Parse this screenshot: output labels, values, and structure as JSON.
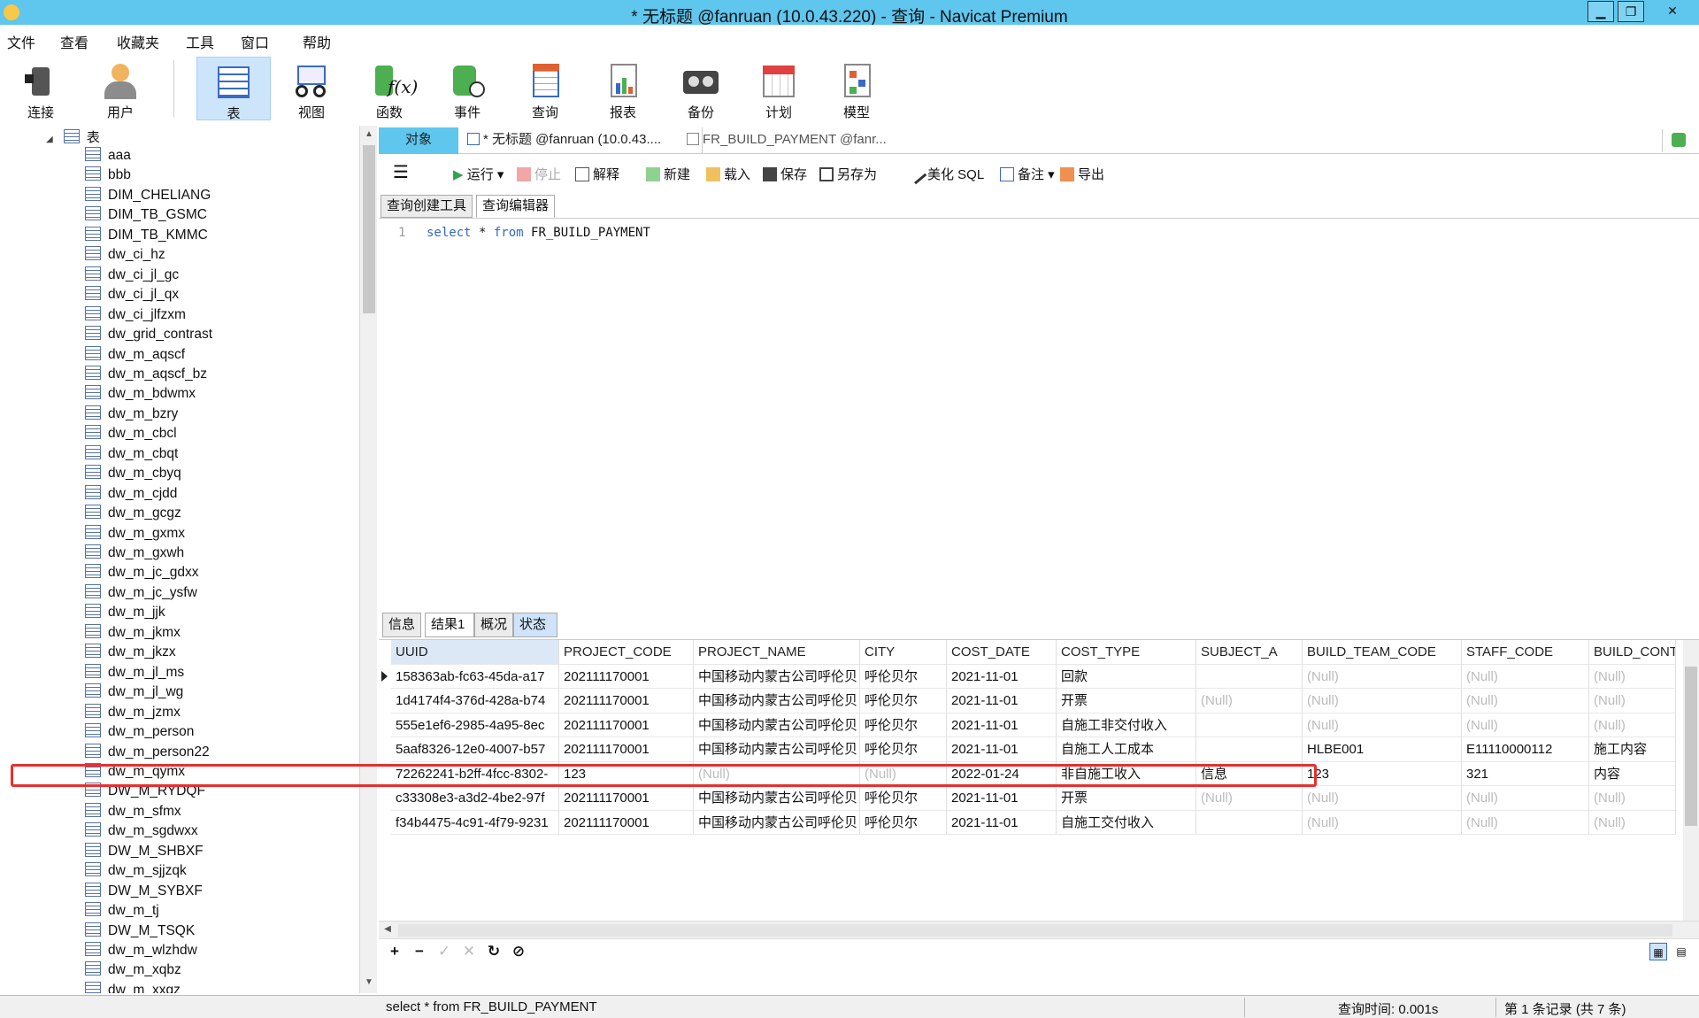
{
  "window": {
    "title": "* 无标题 @fanruan (10.0.43.220) - 查询 - Navicat Premium",
    "minimize": "▁",
    "restore": "❐",
    "close": "✕"
  },
  "menu": [
    "文件",
    "查看",
    "收藏夹",
    "工具",
    "窗口",
    "帮助"
  ],
  "toolbar": [
    {
      "label": "连接",
      "icon": "plug-icon"
    },
    {
      "label": "用户",
      "icon": "user-icon"
    },
    {
      "label": "表",
      "icon": "table-icon",
      "active": true
    },
    {
      "label": "视图",
      "icon": "glasses-icon"
    },
    {
      "label": "函数",
      "icon": "function-icon"
    },
    {
      "label": "事件",
      "icon": "event-icon"
    },
    {
      "label": "查询",
      "icon": "query-icon"
    },
    {
      "label": "报表",
      "icon": "report-icon"
    },
    {
      "label": "备份",
      "icon": "backup-icon"
    },
    {
      "label": "计划",
      "icon": "calendar-icon"
    },
    {
      "label": "模型",
      "icon": "model-icon"
    }
  ],
  "tree": {
    "root": "表",
    "items": [
      "aaa",
      "bbb",
      "DIM_CHELIANG",
      "DIM_TB_GSMC",
      "DIM_TB_KMMC",
      "dw_ci_hz",
      "dw_ci_jl_gc",
      "dw_ci_jl_qx",
      "dw_ci_jlfzxm",
      "dw_grid_contrast",
      "dw_m_aqscf",
      "dw_m_aqscf_bz",
      "dw_m_bdwmx",
      "dw_m_bzry",
      "dw_m_cbcl",
      "dw_m_cbqt",
      "dw_m_cbyq",
      "dw_m_cjdd",
      "dw_m_gcgz",
      "dw_m_gxmx",
      "dw_m_gxwh",
      "dw_m_jc_gdxx",
      "dw_m_jc_ysfw",
      "dw_m_jjk",
      "dw_m_jkmx",
      "dw_m_jkzx",
      "dw_m_jl_ms",
      "dw_m_jl_wg",
      "dw_m_jzmx",
      "dw_m_person",
      "dw_m_person22",
      "dw_m_qymx",
      "DW_M_RYDQF",
      "dw_m_sfmx",
      "dw_m_sgdwxx",
      "DW_M_SHBXF",
      "dw_m_sjjzqk",
      "DW_M_SYBXF",
      "dw_m_tj",
      "DW_M_TSQK",
      "dw_m_wlzhdw",
      "dw_m_xqbz",
      "dw_m_xxqz"
    ]
  },
  "tabs": {
    "object": "对象",
    "query": "* 无标题 @fanruan (10.0.43....",
    "table": "FR_BUILD_PAYMENT @fanr..."
  },
  "query_toolbar": {
    "menu": "☰",
    "run": "运行",
    "stop": "停止",
    "explain": "解释",
    "new": "新建",
    "load": "载入",
    "save": "保存",
    "save_as": "另存为",
    "beautify": "美化 SQL",
    "comment": "备注",
    "export": "导出"
  },
  "subtabs": [
    "查询创建工具",
    "查询编辑器"
  ],
  "editor": {
    "line": "1",
    "kw1": "select",
    "mid": " * ",
    "kw2": "from",
    "rest": " FR_BUILD_PAYMENT"
  },
  "result_tabs": [
    "信息",
    "结果1",
    "概况",
    "状态"
  ],
  "grid": {
    "columns": [
      "UUID",
      "PROJECT_CODE",
      "PROJECT_NAME",
      "CITY",
      "COST_DATE",
      "COST_TYPE",
      "SUBJECT_A",
      "BUILD_TEAM_CODE",
      "STAFF_CODE",
      "BUILD_CONT"
    ],
    "rows": [
      [
        "158363ab-fc63-45da-a17",
        "202111170001",
        "中国移动内蒙古公司呼伦贝",
        "呼伦贝尔",
        "2021-11-01",
        "回款",
        "",
        "(Null)",
        "(Null)",
        "(Null)"
      ],
      [
        "1d4174f4-376d-428a-b74",
        "202111170001",
        "中国移动内蒙古公司呼伦贝",
        "呼伦贝尔",
        "2021-11-01",
        "开票",
        "(Null)",
        "(Null)",
        "(Null)",
        "(Null)"
      ],
      [
        "555e1ef6-2985-4a95-8ec",
        "202111170001",
        "中国移动内蒙古公司呼伦贝",
        "呼伦贝尔",
        "2021-11-01",
        "自施工非交付收入",
        "",
        "(Null)",
        "(Null)",
        "(Null)"
      ],
      [
        "5aaf8326-12e0-4007-b57",
        "202111170001",
        "中国移动内蒙古公司呼伦贝",
        "呼伦贝尔",
        "2021-11-01",
        "自施工人工成本",
        "",
        "HLBE001",
        "E11110000112",
        "施工内容"
      ],
      [
        "72262241-b2ff-4fcc-8302-",
        "123",
        "(Null)",
        "(Null)",
        "2022-01-24",
        "非自施工收入",
        "信息",
        "123",
        "321",
        "内容"
      ],
      [
        "c33308e3-a3d2-4be2-97f",
        "202111170001",
        "中国移动内蒙古公司呼伦贝",
        "呼伦贝尔",
        "2021-11-01",
        "开票",
        "(Null)",
        "(Null)",
        "(Null)",
        "(Null)"
      ],
      [
        "f34b4475-4c91-4f79-9231",
        "202111170001",
        "中国移动内蒙古公司呼伦贝",
        "呼伦贝尔",
        "2021-11-01",
        "自施工交付收入",
        "",
        "(Null)",
        "(Null)",
        "(Null)"
      ]
    ]
  },
  "status": {
    "sql": "select * from FR_BUILD_PAYMENT",
    "time": "查询时间: 0.001s",
    "records": "第 1 条记录 (共 7 条)"
  }
}
